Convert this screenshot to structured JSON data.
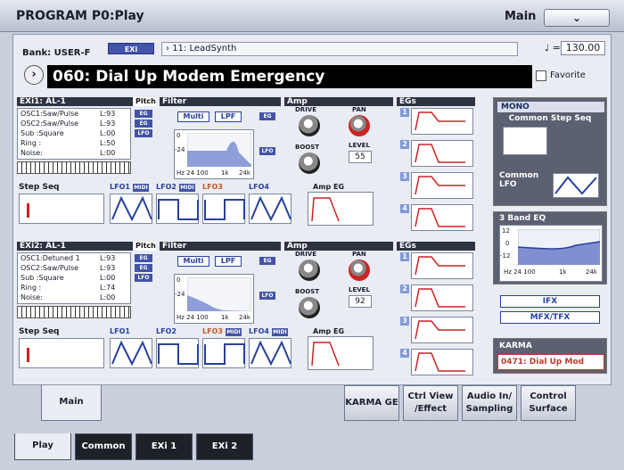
{
  "title": "PROGRAM P0:Play",
  "mode": "Main",
  "bank": {
    "label": "Bank: USER-F",
    "badge": "EXi",
    "category": "11: LeadSynth"
  },
  "tempo": {
    "symbol": "♩ =",
    "value": "130.00"
  },
  "program": {
    "name": "060: Dial Up Modem Emergency",
    "favorite": "Favorite"
  },
  "exi1": {
    "header": "EXi1: AL-1",
    "pitch": "Pitch",
    "filter": "Filter",
    "amp": "Amp",
    "egs": "EGs",
    "rows": [
      {
        "name": "OSC1:Saw/Pulse",
        "level": "L:93",
        "tag": "EG"
      },
      {
        "name": "OSC2:Saw/Pulse",
        "level": "L:93",
        "tag": "EG"
      },
      {
        "name": "Sub  :Square",
        "level": "L:00",
        "tag": "LFO"
      },
      {
        "name": "Ring  :",
        "level": "L:50",
        "tag": ""
      },
      {
        "name": "Noise:",
        "level": "L:00",
        "tag": ""
      }
    ],
    "filter_type": "Multi",
    "filter_mode": "LPF",
    "filter_eg": "EG",
    "filter_lfo": "LFO",
    "drive": "DRIVE",
    "boost": "BOOST",
    "pan": "PAN",
    "level": "LEVEL",
    "level_value": "55",
    "axis": {
      "db0": "0",
      "db24": "-24",
      "hz": "Hz 24 100",
      "k1": "1k",
      "k24": "24k"
    },
    "stepseq": "Step Seq",
    "lfos": [
      "LFO1",
      "LFO2",
      "LFO3",
      "LFO4"
    ],
    "lfo_midi": [
      "MIDI",
      "MIDI",
      "",
      ""
    ],
    "amp_eg": "Amp EG",
    "eg_nums": [
      "1",
      "2",
      "3",
      "4"
    ]
  },
  "exi2": {
    "header": "EXi2: AL-1",
    "pitch": "Pitch",
    "filter": "Filter",
    "amp": "Amp",
    "egs": "EGs",
    "rows": [
      {
        "name": "OSC1:Detuned 1",
        "level": "L:93",
        "tag": "EG"
      },
      {
        "name": "OSC2:Saw/Pulse",
        "level": "L:93",
        "tag": "EG"
      },
      {
        "name": "Sub  :Square",
        "level": "L:00",
        "tag": "LFO"
      },
      {
        "name": "Ring  :",
        "level": "L:74",
        "tag": ""
      },
      {
        "name": "Noise:",
        "level": "L:00",
        "tag": ""
      }
    ],
    "filter_type": "Multi",
    "filter_mode": "LPF",
    "filter_eg": "EG",
    "filter_lfo": "LFO",
    "drive": "DRIVE",
    "boost": "BOOST",
    "pan": "PAN",
    "level": "LEVEL",
    "level_value": "92",
    "axis": {
      "db0": "0",
      "db24": "-24",
      "hz": "Hz 24 100",
      "k1": "1k",
      "k24": "24k"
    },
    "stepseq": "Step Seq",
    "lfos": [
      "LFO1",
      "LFO2",
      "LFO3",
      "LFO4"
    ],
    "lfo_midi": [
      "",
      "",
      "MIDI",
      "MIDI"
    ],
    "amp_eg": "Amp EG",
    "eg_nums": [
      "1",
      "2",
      "3",
      "4"
    ]
  },
  "common": {
    "mono": "MONO",
    "step_seq": "Common Step Seq",
    "lfo": "Common LFO",
    "eq_title": "3 Band EQ",
    "eq_axis": {
      "p12": "12",
      "z": "0",
      "m12": "-12",
      "hz": "Hz 24 100",
      "k1": "1k",
      "k24": "24k"
    },
    "ifx": "IFX",
    "mfx": "MFX/TFX",
    "karma_title": "KARMA",
    "karma_value": "0471: Dial Up Mod"
  },
  "page_tabs": [
    {
      "label": "Main"
    },
    {
      "label": "KARMA GE"
    },
    {
      "label": "Ctrl View /Effect"
    },
    {
      "label": "Audio In/ Sampling"
    },
    {
      "label": "Control Surface"
    }
  ],
  "bottom_tabs": [
    "Play",
    "Common",
    "EXi 1",
    "EXi 2"
  ],
  "colors": {
    "accent": "#4253a8",
    "karma": "#c0392b",
    "panel": "#3a4466"
  }
}
